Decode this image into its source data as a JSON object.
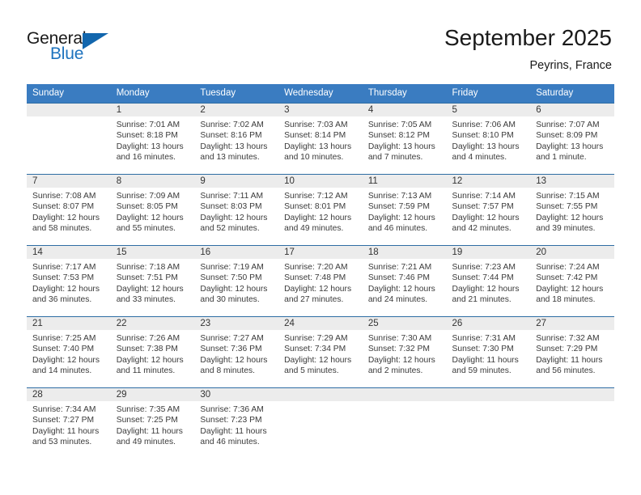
{
  "brand": {
    "name_part1": "General",
    "name_part2": "Blue",
    "accent_color": "#1266ad"
  },
  "header": {
    "month_title": "September 2025",
    "location": "Peyrins, France"
  },
  "theme": {
    "header_row_bg": "#3a7cc1",
    "day_number_bg": "#ececec",
    "row_divider": "#2e6da4"
  },
  "weekday_headers": [
    "Sunday",
    "Monday",
    "Tuesday",
    "Wednesday",
    "Thursday",
    "Friday",
    "Saturday"
  ],
  "weeks": [
    [
      {
        "day": "",
        "sunrise": "",
        "sunset": "",
        "daylight": "",
        "empty": true
      },
      {
        "day": "1",
        "sunrise": "Sunrise: 7:01 AM",
        "sunset": "Sunset: 8:18 PM",
        "daylight": "Daylight: 13 hours and 16 minutes."
      },
      {
        "day": "2",
        "sunrise": "Sunrise: 7:02 AM",
        "sunset": "Sunset: 8:16 PM",
        "daylight": "Daylight: 13 hours and 13 minutes."
      },
      {
        "day": "3",
        "sunrise": "Sunrise: 7:03 AM",
        "sunset": "Sunset: 8:14 PM",
        "daylight": "Daylight: 13 hours and 10 minutes."
      },
      {
        "day": "4",
        "sunrise": "Sunrise: 7:05 AM",
        "sunset": "Sunset: 8:12 PM",
        "daylight": "Daylight: 13 hours and 7 minutes."
      },
      {
        "day": "5",
        "sunrise": "Sunrise: 7:06 AM",
        "sunset": "Sunset: 8:10 PM",
        "daylight": "Daylight: 13 hours and 4 minutes."
      },
      {
        "day": "6",
        "sunrise": "Sunrise: 7:07 AM",
        "sunset": "Sunset: 8:09 PM",
        "daylight": "Daylight: 13 hours and 1 minute."
      }
    ],
    [
      {
        "day": "7",
        "sunrise": "Sunrise: 7:08 AM",
        "sunset": "Sunset: 8:07 PM",
        "daylight": "Daylight: 12 hours and 58 minutes."
      },
      {
        "day": "8",
        "sunrise": "Sunrise: 7:09 AM",
        "sunset": "Sunset: 8:05 PM",
        "daylight": "Daylight: 12 hours and 55 minutes."
      },
      {
        "day": "9",
        "sunrise": "Sunrise: 7:11 AM",
        "sunset": "Sunset: 8:03 PM",
        "daylight": "Daylight: 12 hours and 52 minutes."
      },
      {
        "day": "10",
        "sunrise": "Sunrise: 7:12 AM",
        "sunset": "Sunset: 8:01 PM",
        "daylight": "Daylight: 12 hours and 49 minutes."
      },
      {
        "day": "11",
        "sunrise": "Sunrise: 7:13 AM",
        "sunset": "Sunset: 7:59 PM",
        "daylight": "Daylight: 12 hours and 46 minutes."
      },
      {
        "day": "12",
        "sunrise": "Sunrise: 7:14 AM",
        "sunset": "Sunset: 7:57 PM",
        "daylight": "Daylight: 12 hours and 42 minutes."
      },
      {
        "day": "13",
        "sunrise": "Sunrise: 7:15 AM",
        "sunset": "Sunset: 7:55 PM",
        "daylight": "Daylight: 12 hours and 39 minutes."
      }
    ],
    [
      {
        "day": "14",
        "sunrise": "Sunrise: 7:17 AM",
        "sunset": "Sunset: 7:53 PM",
        "daylight": "Daylight: 12 hours and 36 minutes."
      },
      {
        "day": "15",
        "sunrise": "Sunrise: 7:18 AM",
        "sunset": "Sunset: 7:51 PM",
        "daylight": "Daylight: 12 hours and 33 minutes."
      },
      {
        "day": "16",
        "sunrise": "Sunrise: 7:19 AM",
        "sunset": "Sunset: 7:50 PM",
        "daylight": "Daylight: 12 hours and 30 minutes."
      },
      {
        "day": "17",
        "sunrise": "Sunrise: 7:20 AM",
        "sunset": "Sunset: 7:48 PM",
        "daylight": "Daylight: 12 hours and 27 minutes."
      },
      {
        "day": "18",
        "sunrise": "Sunrise: 7:21 AM",
        "sunset": "Sunset: 7:46 PM",
        "daylight": "Daylight: 12 hours and 24 minutes."
      },
      {
        "day": "19",
        "sunrise": "Sunrise: 7:23 AM",
        "sunset": "Sunset: 7:44 PM",
        "daylight": "Daylight: 12 hours and 21 minutes."
      },
      {
        "day": "20",
        "sunrise": "Sunrise: 7:24 AM",
        "sunset": "Sunset: 7:42 PM",
        "daylight": "Daylight: 12 hours and 18 minutes."
      }
    ],
    [
      {
        "day": "21",
        "sunrise": "Sunrise: 7:25 AM",
        "sunset": "Sunset: 7:40 PM",
        "daylight": "Daylight: 12 hours and 14 minutes."
      },
      {
        "day": "22",
        "sunrise": "Sunrise: 7:26 AM",
        "sunset": "Sunset: 7:38 PM",
        "daylight": "Daylight: 12 hours and 11 minutes."
      },
      {
        "day": "23",
        "sunrise": "Sunrise: 7:27 AM",
        "sunset": "Sunset: 7:36 PM",
        "daylight": "Daylight: 12 hours and 8 minutes."
      },
      {
        "day": "24",
        "sunrise": "Sunrise: 7:29 AM",
        "sunset": "Sunset: 7:34 PM",
        "daylight": "Daylight: 12 hours and 5 minutes."
      },
      {
        "day": "25",
        "sunrise": "Sunrise: 7:30 AM",
        "sunset": "Sunset: 7:32 PM",
        "daylight": "Daylight: 12 hours and 2 minutes."
      },
      {
        "day": "26",
        "sunrise": "Sunrise: 7:31 AM",
        "sunset": "Sunset: 7:30 PM",
        "daylight": "Daylight: 11 hours and 59 minutes."
      },
      {
        "day": "27",
        "sunrise": "Sunrise: 7:32 AM",
        "sunset": "Sunset: 7:29 PM",
        "daylight": "Daylight: 11 hours and 56 minutes."
      }
    ],
    [
      {
        "day": "28",
        "sunrise": "Sunrise: 7:34 AM",
        "sunset": "Sunset: 7:27 PM",
        "daylight": "Daylight: 11 hours and 53 minutes."
      },
      {
        "day": "29",
        "sunrise": "Sunrise: 7:35 AM",
        "sunset": "Sunset: 7:25 PM",
        "daylight": "Daylight: 11 hours and 49 minutes."
      },
      {
        "day": "30",
        "sunrise": "Sunrise: 7:36 AM",
        "sunset": "Sunset: 7:23 PM",
        "daylight": "Daylight: 11 hours and 46 minutes."
      },
      {
        "day": "",
        "sunrise": "",
        "sunset": "",
        "daylight": "",
        "empty": true
      },
      {
        "day": "",
        "sunrise": "",
        "sunset": "",
        "daylight": "",
        "empty": true
      },
      {
        "day": "",
        "sunrise": "",
        "sunset": "",
        "daylight": "",
        "empty": true
      },
      {
        "day": "",
        "sunrise": "",
        "sunset": "",
        "daylight": "",
        "empty": true
      }
    ]
  ]
}
